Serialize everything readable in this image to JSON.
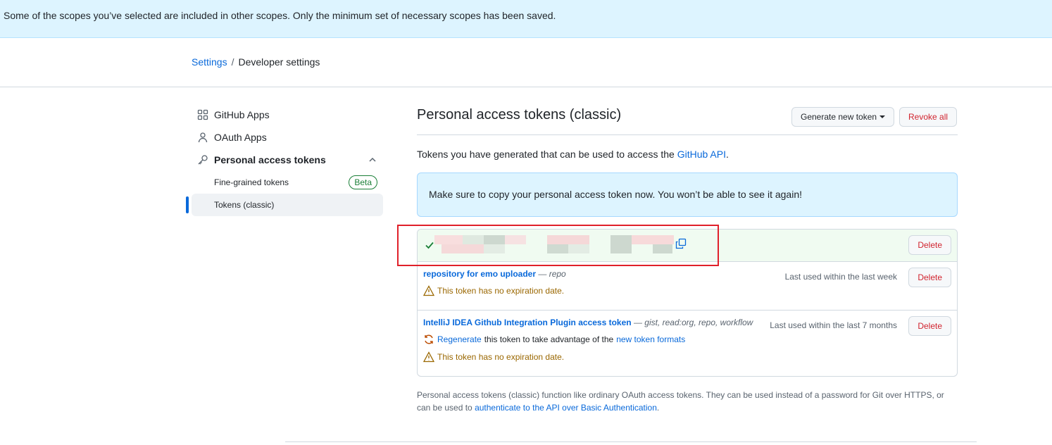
{
  "flash": {
    "message": "Some of the scopes you’ve selected are included in other scopes. Only the minimum set of necessary scopes has been saved."
  },
  "breadcrumb": {
    "settings": "Settings",
    "separator": "/",
    "current": "Developer settings"
  },
  "sidebar": {
    "github_apps": "GitHub Apps",
    "oauth_apps": "OAuth Apps",
    "personal_access_tokens": "Personal access tokens",
    "fine_grained": "Fine-grained tokens",
    "beta": "Beta",
    "classic": "Tokens (classic)"
  },
  "main": {
    "title": "Personal access tokens (classic)",
    "generate_button": "Generate new token",
    "revoke_all": "Revoke all",
    "desc_prefix": "Tokens you have generated that can be used to access the ",
    "desc_link": "GitHub API",
    "desc_suffix": ".",
    "notice": "Make sure to copy your personal access token now. You won’t be able to see it again!"
  },
  "tokens": {
    "delete": "Delete",
    "t1": {
      "name": "repository for emo uploader",
      "scopes": " — repo",
      "last_used": "Last used within the last week",
      "warning": "This token has no expiration date."
    },
    "t2": {
      "name": "IntelliJ IDEA Github Integration Plugin access token",
      "scopes": " — gist, read:org, repo, workflow",
      "last_used": "Last used within the last 7 months",
      "regen_link": "Regenerate",
      "regen_mid": " this token to take advantage of the ",
      "regen_link2": "new token formats",
      "warning": "This token has no expiration date."
    }
  },
  "footnote": {
    "text": "Personal access tokens (classic) function like ordinary OAuth access tokens. They can be used instead of a password for Git over HTTPS, or can be used to ",
    "link": "authenticate to the API over Basic Authentication",
    "suffix": "."
  }
}
